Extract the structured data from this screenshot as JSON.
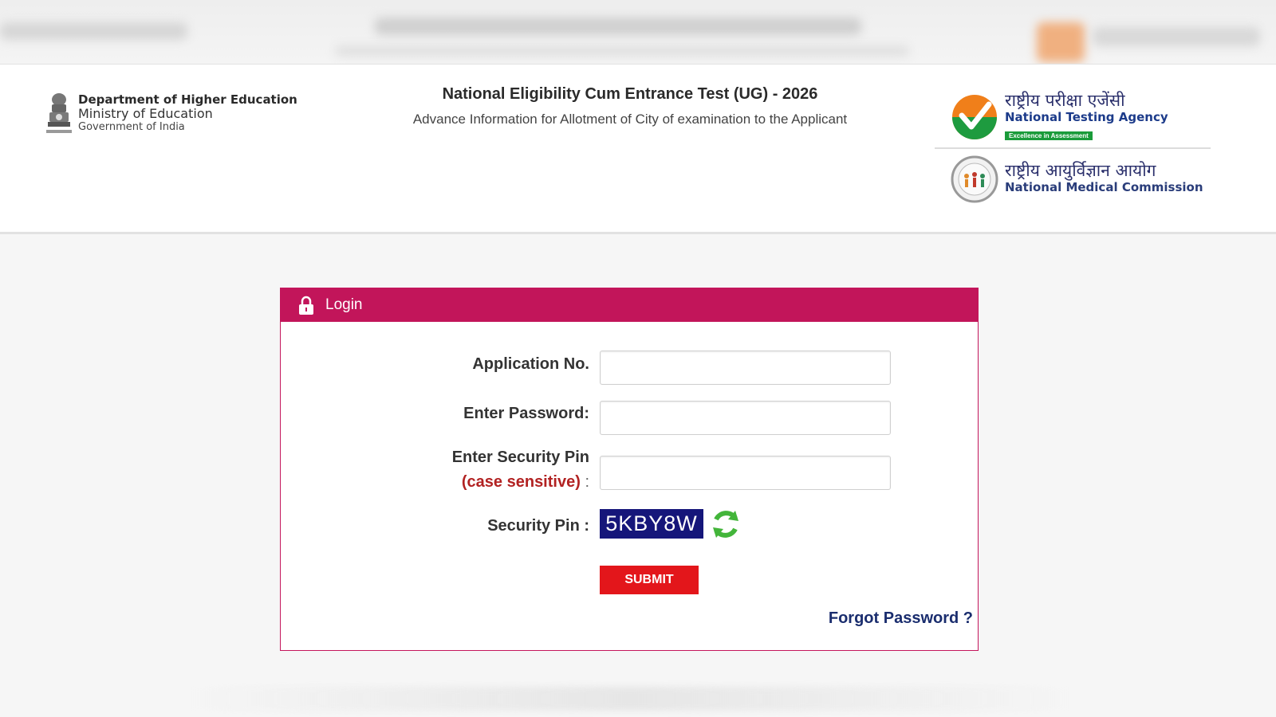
{
  "header": {
    "dept_line1": "Department of Higher Education",
    "dept_line2": "Ministry of Education",
    "dept_line3": "Government of India",
    "main_title": "National Eligibility Cum Entrance Test (UG) - 2026",
    "sub_title": "Advance Information for Allotment of City of examination to the Applicant",
    "nta": {
      "hindi": "राष्ट्रीय परीक्षा एजेंसी",
      "english": "National Testing Agency",
      "tagline": "Excellence in Assessment"
    },
    "nmc": {
      "hindi": "राष्ट्रीय आयुर्विज्ञान आयोग",
      "english": "National Medical Commission"
    }
  },
  "login": {
    "title": "Login",
    "application_label": "Application No.",
    "application_value": "",
    "password_label": "Enter Password:",
    "password_value": "",
    "security_pin_label": "Enter Security Pin",
    "case_sensitive_label": "(case sensitive)",
    "case_colon": ":",
    "security_pin_value": "",
    "captcha_label": "Security Pin :",
    "captcha_value": "5KBY8W",
    "submit_label": "SUBMIT",
    "forgot_label": "Forgot Password ?"
  },
  "colors": {
    "login_header": "#c2155a",
    "submit": "#e3161b",
    "captcha_bg": "#15167a",
    "link": "#1a2d6e"
  },
  "icons": {
    "lock": "lock-icon",
    "refresh": "refresh-icon",
    "emblem": "national-emblem-icon",
    "nta_logo": "nta-logo-icon",
    "nmc_logo": "nmc-logo-icon"
  }
}
